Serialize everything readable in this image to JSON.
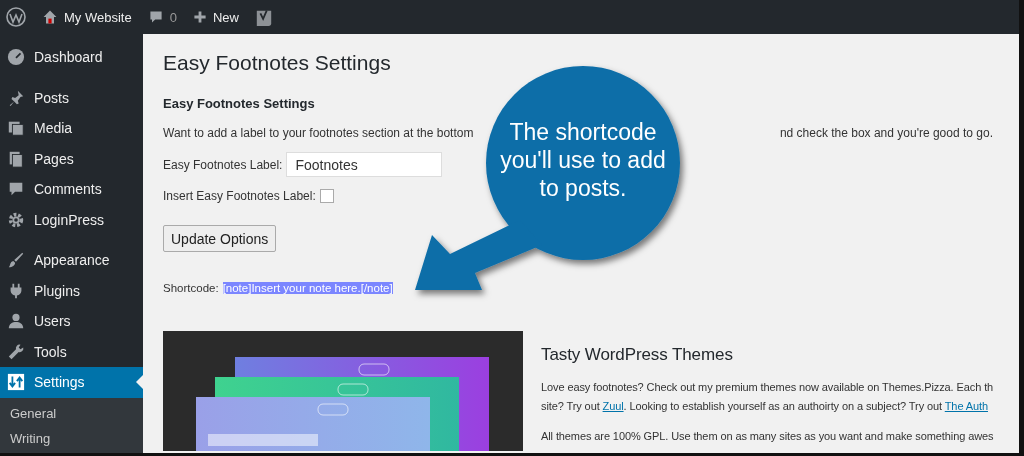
{
  "admin_bar": {
    "site_name": "My Website",
    "comments_count": "0",
    "new_label": "New"
  },
  "sidebar": {
    "groups": [
      [
        {
          "label": "Dashboard",
          "selected": false
        }
      ],
      [
        {
          "label": "Posts",
          "selected": false
        },
        {
          "label": "Media",
          "selected": false
        },
        {
          "label": "Pages",
          "selected": false
        },
        {
          "label": "Comments",
          "selected": false
        },
        {
          "label": "LoginPress",
          "selected": false
        }
      ],
      [
        {
          "label": "Appearance",
          "selected": false
        },
        {
          "label": "Plugins",
          "selected": false
        },
        {
          "label": "Users",
          "selected": false
        },
        {
          "label": "Tools",
          "selected": false
        },
        {
          "label": "Settings",
          "selected": true
        }
      ]
    ],
    "submenu": [
      {
        "label": "General",
        "selected": false
      },
      {
        "label": "Writing",
        "selected": false
      }
    ]
  },
  "page": {
    "title": "Easy Footnotes Settings",
    "section_title": "Easy Footnotes Settings",
    "description_start": "Want to add a label to your footnotes section at the bottom",
    "description_end": "nd check the box and you're good to go.",
    "label_field": {
      "label": "Easy Footnotes Label:",
      "value": "Footnotes"
    },
    "insert_label": {
      "label": "Insert Easy Footnotes Label:",
      "checked": false
    },
    "button": "Update Options",
    "shortcode_label": "Shortcode:",
    "shortcode": "[note]Insert your note here.[/note]"
  },
  "promo": {
    "title": "Tasty WordPress Themes",
    "lines": [
      [
        {
          "kind": "text",
          "text": "Love easy footnotes? Check out my premium themes now available on Themes.Pizza. Each th"
        }
      ],
      [
        {
          "kind": "text",
          "text": "site? Try out "
        },
        {
          "kind": "link",
          "text": "Zuul"
        },
        {
          "kind": "text",
          "text": ". Looking to establish yourself as an authoirty on a subject? Try out "
        },
        {
          "kind": "link",
          "text": "The Auth"
        }
      ],
      [
        {
          "kind": "gap"
        }
      ],
      [
        {
          "kind": "text",
          "text": "All themes are 100% GPL. Use them on as many sites as you want and make something awes"
        }
      ]
    ]
  },
  "callout": {
    "text": "The shortcode you'll use to add to posts."
  }
}
